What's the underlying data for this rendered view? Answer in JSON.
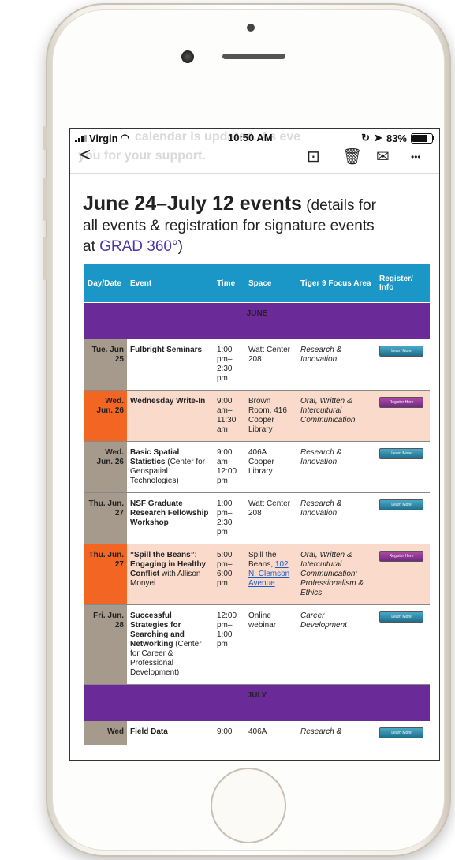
{
  "status": {
    "carrier": "Virgin",
    "time": "10:50 AM",
    "battery": "83%",
    "ghost_text_1": "calendar is updated. As eve",
    "ghost_text_2": "you for your support."
  },
  "toolbar": {
    "back": "<",
    "archive": "⊡",
    "trash": "🗑",
    "mail": "✉",
    "more": "•••"
  },
  "heading": {
    "title": "June 24–July 12 events",
    "details_prefix": " (details for",
    "line2": "all events & registration for signature events",
    "line3_prefix": "at ",
    "link": "GRAD 360°",
    "line3_suffix": ")"
  },
  "table": {
    "headers": [
      "Day/Date",
      "Event",
      "Time",
      "Space",
      "Tiger 9 Focus Area",
      "Register/ Info"
    ],
    "month_june": "JUNE",
    "month_july": "JULY",
    "rows": [
      {
        "date": "Tue. Jun 25",
        "event": "Fulbright Seminars",
        "event_extra": "",
        "time": "1:00 pm– 2:30 pm",
        "space": "Watt Center 208",
        "space_link": "",
        "focus": "Research & Innovation",
        "button": "Learn More"
      },
      {
        "date": "Wed. Jun. 26",
        "event": "Wednesday Write-In",
        "event_extra": "",
        "time": "9:00 am– 11:30 am",
        "space": "Brown Room, 416 Cooper Library",
        "space_link": "",
        "focus": "Oral, Written & Intercultural Communication",
        "button": "Register Here"
      },
      {
        "date": "Wed. Jun. 26",
        "event": "Basic Spatial Statistics",
        "event_extra": " (Center for Geospatial Technologies)",
        "time": "9:00 am– 12:00 pm",
        "space": "406A Cooper Library",
        "space_link": "",
        "focus": "Research & Innovation",
        "button": "Learn More"
      },
      {
        "date": "Thu. Jun. 27",
        "event": "NSF Graduate Research Fellowship Workshop",
        "event_extra": "",
        "time": "1:00 pm– 2:30 pm",
        "space": "Watt Center 208",
        "space_link": "",
        "focus": "Research & Innovation",
        "button": "Learn More"
      },
      {
        "date": "Thu. Jun. 27",
        "event": "“Spill the Beans”: Engaging in Healthy Conflict",
        "event_extra": " with Allison Monyei",
        "time": "5:00 pm– 6:00 pm",
        "space": "Spill the Beans, ",
        "space_link": "102 N. Clemson Avenue",
        "focus": "Oral, Written & Intercultural Communication; Professionalism & Ethics",
        "button": "Register Here"
      },
      {
        "date": "Fri. Jun. 28",
        "event": "Successful Strategies for Searching and Networking",
        "event_extra": " (Center for Career & Professional Development)",
        "time": "12:00 pm– 1:00 pm",
        "space": "Online webinar",
        "space_link": "",
        "focus": "Career Development",
        "button": "Learn More"
      }
    ],
    "partial_row": {
      "date": "Wed",
      "event": "Field Data",
      "time": "9:00",
      "space": "406A",
      "focus": "Research &",
      "button": "Learn More"
    }
  },
  "colors": {
    "header_blue": "#1a97c6",
    "month_purple": "#6a2b98",
    "date_grey": "#a69a8c",
    "date_orange": "#f26522",
    "row_peach": "#fadbcb",
    "link_purple": "#4a3aa8"
  }
}
